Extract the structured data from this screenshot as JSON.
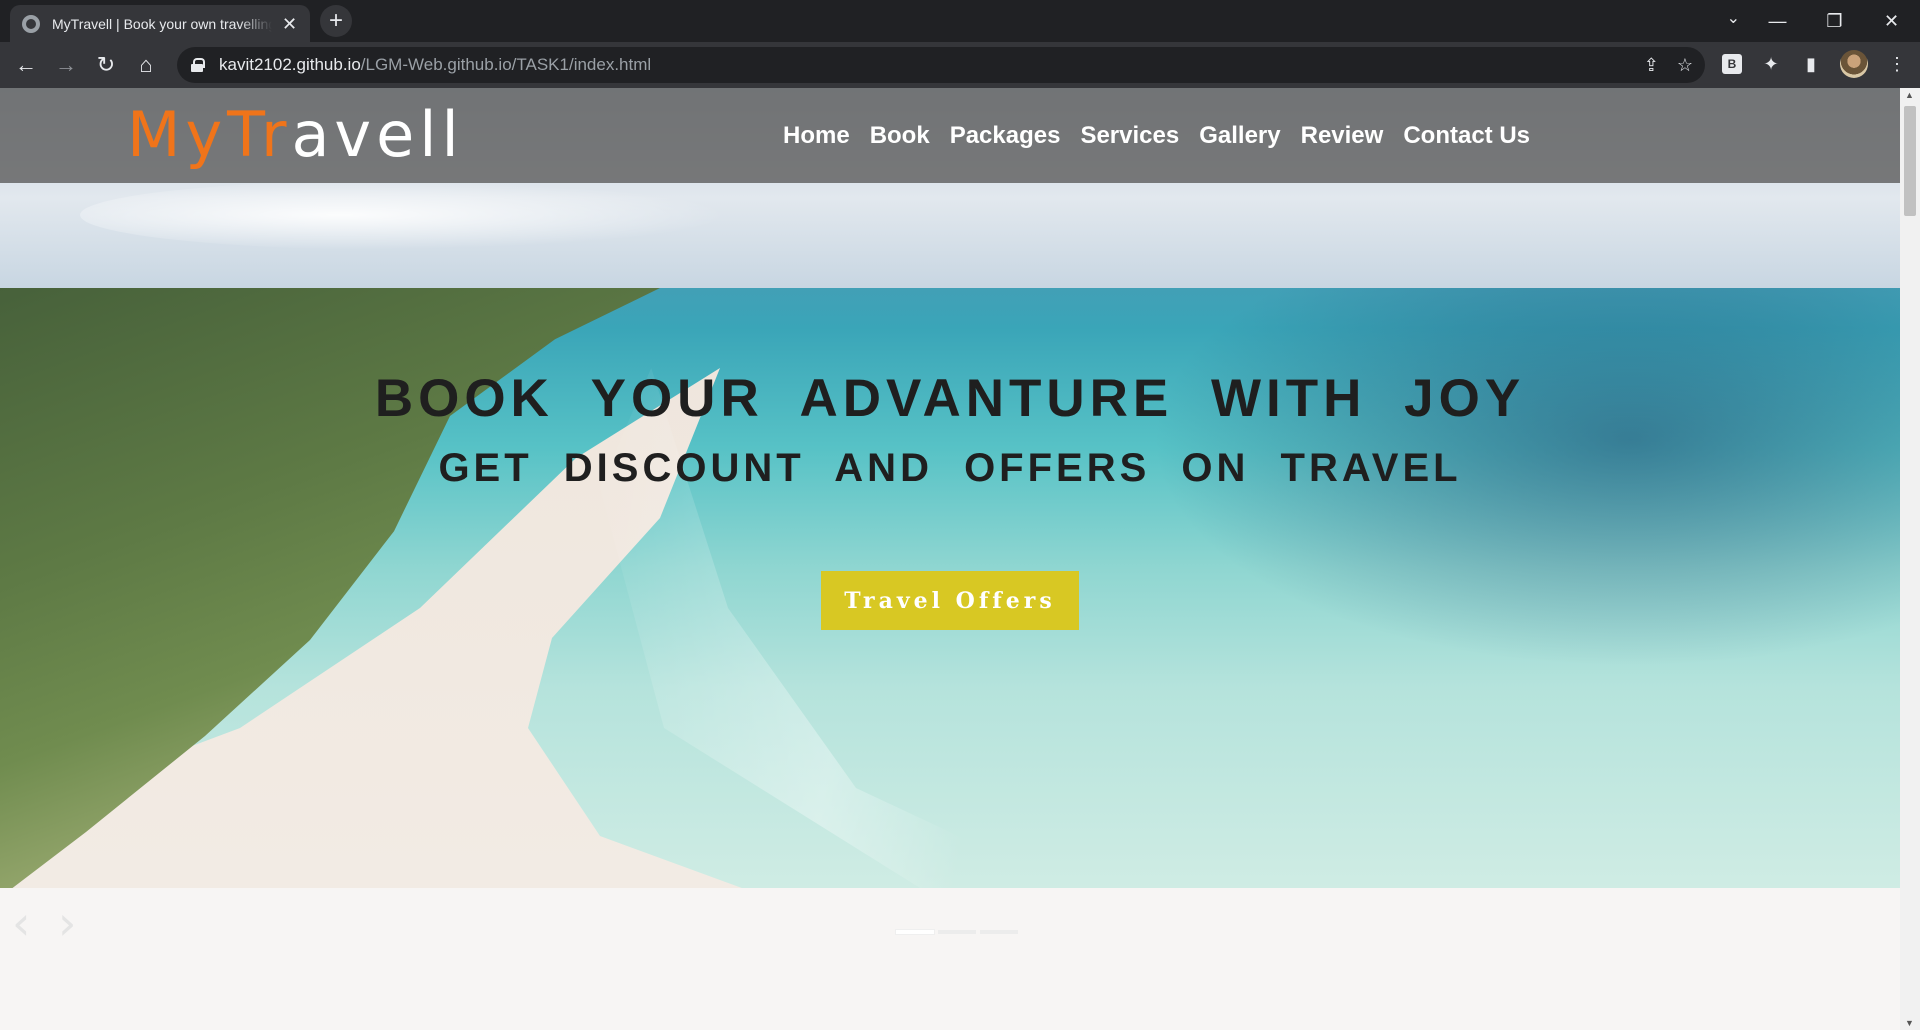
{
  "browser": {
    "tab_title": "MyTravell | Book your own travelling",
    "url_host": "kavit2102.github.io",
    "url_path": "/LGM-Web.github.io/TASK1/index.html",
    "icons": [
      "globe-icon",
      "close-icon",
      "plus-icon",
      "chevron-down-icon",
      "minimize-icon",
      "restore-icon",
      "close-window-icon",
      "back-icon",
      "forward-icon",
      "reload-icon",
      "home-icon",
      "lock-icon",
      "share-icon",
      "star-icon",
      "extension-b-icon",
      "puzzle-icon",
      "sidepanel-icon",
      "avatar",
      "kebab-icon"
    ]
  },
  "site": {
    "logo_accent": "MyTr",
    "logo_rest": "avell",
    "nav": [
      "Home",
      "Book",
      "Packages",
      "Services",
      "Gallery",
      "Review",
      "Contact Us"
    ],
    "headline": "BOOK YOUR ADVANTURE WITH JOY",
    "subheadline": "GET DISCOUNT AND OFFERS ON TRAVEL",
    "cta_label": "Travel Offers",
    "carousel": {
      "prev": "‹",
      "next": "›",
      "slides": 3,
      "active": 1
    }
  },
  "colors": {
    "logo_accent": "#f0741a",
    "cta_bg": "#d8c823",
    "header_bg": "#5f5f5f"
  }
}
